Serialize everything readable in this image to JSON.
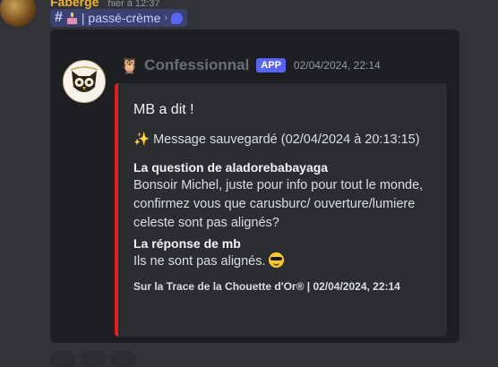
{
  "author": {
    "name": "Faberge",
    "time": "hier à 12:37"
  },
  "channel_pill": {
    "label": "| passé-crème",
    "icons": [
      "hash-icon",
      "cake-icon",
      "chevron-right-icon",
      "thread-icon"
    ]
  },
  "bot": {
    "owl_emoji": "🦉",
    "name": "Confessionnal",
    "badge": "APP",
    "timestamp": "02/04/2024, 22:14"
  },
  "embed": {
    "accent_color": "#e0211f",
    "title": "MB a dit !",
    "description_emoji": "✨",
    "description": "Message sauvegardé (02/04/2024 à 20:13:15)",
    "fields": [
      {
        "name": "La question de aladorebabayaga",
        "value": "Bonsoir Michel, juste pour info pour tout le monde, confirmez vous que carusburc/ ouverture/lumiere celeste sont pas alignés?"
      },
      {
        "name": "La réponse de mb",
        "value": "Ils ne sont pas alignés."
      }
    ],
    "footer": "Sur la Trace de la Chouette d'Or® | 02/04/2024, 22:14"
  },
  "colors": {
    "background": "#313338",
    "card": "#1e1f22",
    "embed": "#2b2d31",
    "badge": "#5865f2",
    "author": "#f0b232"
  }
}
